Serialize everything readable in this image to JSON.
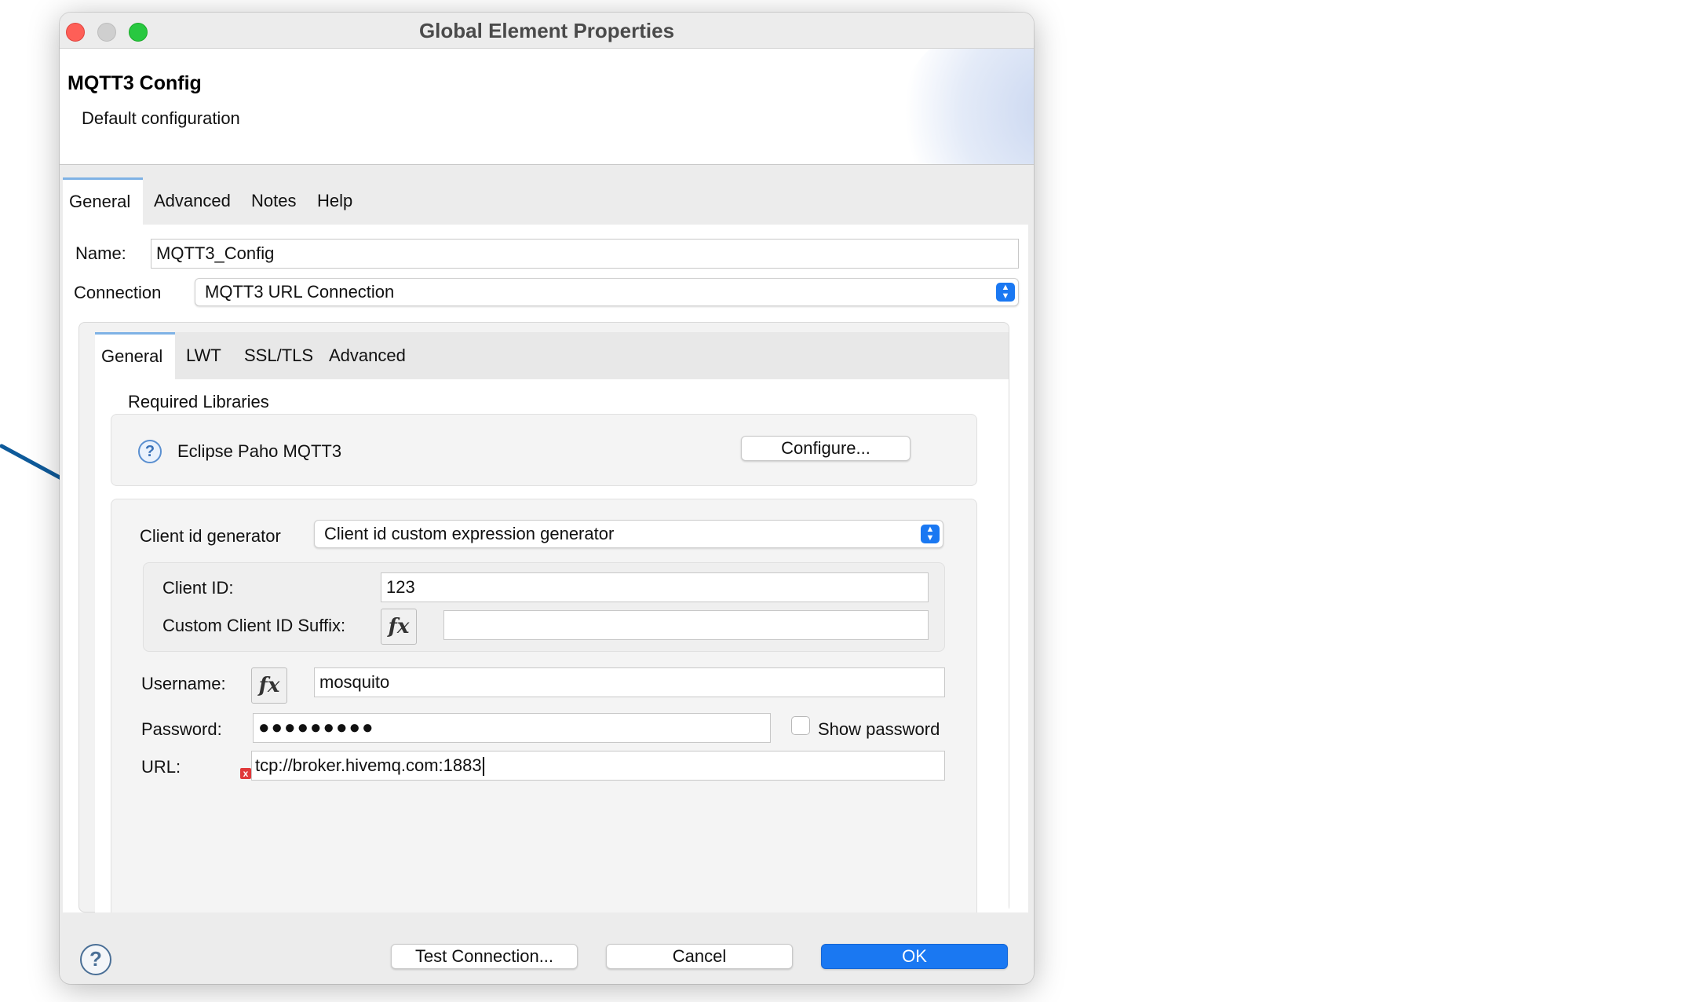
{
  "window": {
    "title": "Global Element Properties"
  },
  "header": {
    "title": "MQTT3 Config",
    "subtitle": "Default configuration"
  },
  "tabs": [
    {
      "label": "General"
    },
    {
      "label": "Advanced"
    },
    {
      "label": "Notes"
    },
    {
      "label": "Help"
    }
  ],
  "general": {
    "name_label": "Name:",
    "name_value": "MQTT3_Config",
    "connection_label": "Connection",
    "connection_value": "MQTT3 URL Connection"
  },
  "inner_tabs": [
    {
      "label": "General"
    },
    {
      "label": "LWT"
    },
    {
      "label": "SSL/TLS"
    },
    {
      "label": "Advanced"
    }
  ],
  "required_libraries": {
    "title": "Required Libraries",
    "library_name": "Eclipse Paho MQTT3",
    "configure_label": "Configure...",
    "help_icon": "?"
  },
  "client_id": {
    "generator_label": "Client id generator",
    "generator_value": "Client id custom expression generator",
    "client_id_label": "Client ID:",
    "client_id_value": "123",
    "suffix_label": "Custom Client ID Suffix:",
    "suffix_value": ""
  },
  "credentials": {
    "username_label": "Username:",
    "username_value": "mosquito",
    "password_label": "Password:",
    "password_value": "●●●●●●●●●",
    "show_password_label": "Show password",
    "url_label": "URL:",
    "url_value": "tcp://broker.hivemq.com:1883",
    "error_icon": "x"
  },
  "fx_label": "fx",
  "footer": {
    "help_icon": "?",
    "test_connection_label": "Test Connection...",
    "cancel_label": "Cancel",
    "ok_label": "OK"
  },
  "colors": {
    "accent": "#1a78f2",
    "arrow": "#0e5a9a",
    "error": "#e0383a"
  }
}
